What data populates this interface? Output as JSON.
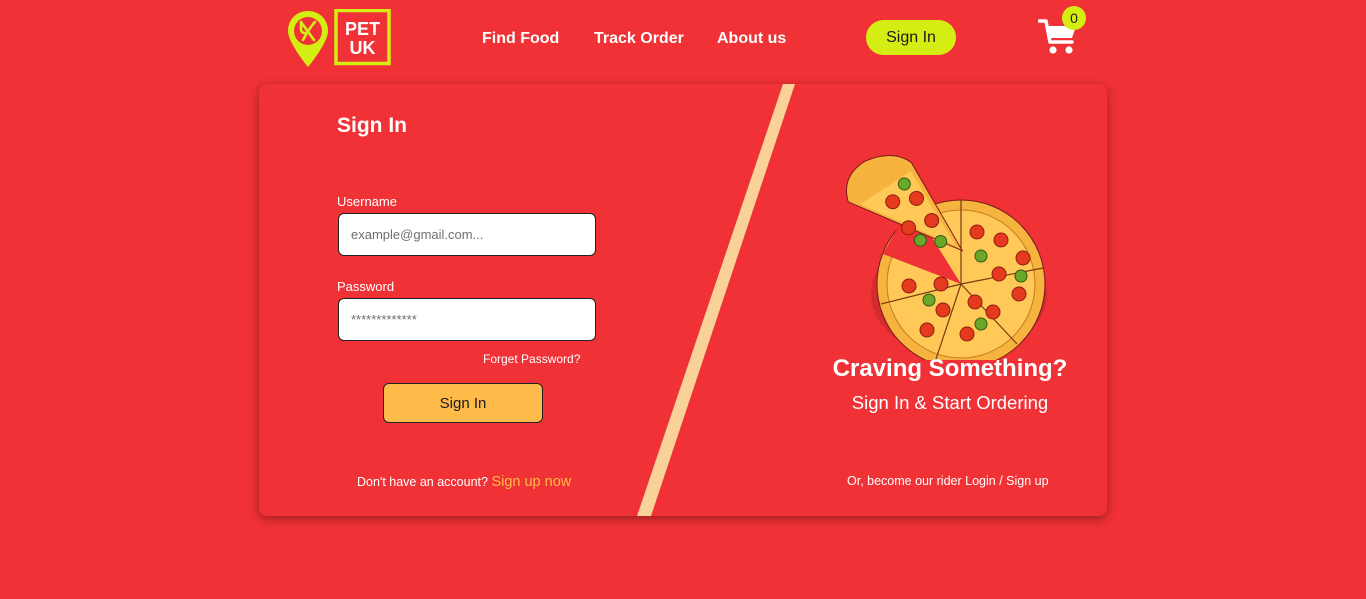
{
  "brand": {
    "logo_text_line1": "PET",
    "logo_text_line2": "UK"
  },
  "nav": {
    "links": [
      "Find Food",
      "Track Order",
      "About us"
    ],
    "signin_label": "Sign In",
    "cart_count": "0",
    "cart_icon": "shopping-cart-icon"
  },
  "form": {
    "title": "Sign In",
    "username_label": "Username",
    "username_placeholder": "example@gmail.com...",
    "password_label": "Password",
    "password_placeholder": "*************",
    "forget_label": "Forget Password?",
    "submit_label": "Sign In",
    "signup_prompt": "Don't have an account?",
    "signup_link": "Sign up now"
  },
  "promo": {
    "headline": "Craving Something?",
    "subline": "Sign In & Start Ordering",
    "rider_prefix": "Or, become our rider",
    "rider_login": "Login",
    "rider_separator": "/",
    "rider_signup": "Sign up"
  },
  "colors": {
    "background": "#f03135",
    "accent_lime": "#d4ee14",
    "accent_orange": "#ffbb4a",
    "stripe": "#f9d29a"
  }
}
